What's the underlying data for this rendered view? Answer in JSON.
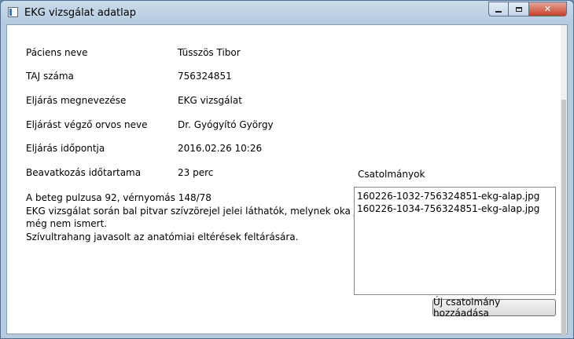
{
  "window": {
    "title": "EKG vizsgálat adatlap",
    "minimize": "minimize",
    "maximize": "maximize",
    "close_glyph": "✕"
  },
  "fields": [
    {
      "label": "Páciens neve",
      "value": "Tüsszös Tibor"
    },
    {
      "label": "TAJ száma",
      "value": "756324851"
    },
    {
      "label": "Eljárás megnevezése",
      "value": "EKG vizsgálat"
    },
    {
      "label": "Eljárást végző orvos neve",
      "value": "Dr. Gyógyító György"
    },
    {
      "label": "Eljárás időpontja",
      "value": "2016.02.26 10:26"
    },
    {
      "label": "Beavatkozás időtartama",
      "value": "23 perc"
    }
  ],
  "notes": [
    "A beteg pulzusa 92, vérnyomás 148/78",
    "EKG vizsgálat során bal pitvar szívzörejel jelei láthatók, melynek oka jelenleg",
    "még nem ismert.",
    "Szívultrahang javasolt az anatómiai eltérések feltárására."
  ],
  "attachments": {
    "title": "Csatolmányok",
    "items": [
      "160226-1032-756324851-ekg-alap.jpg",
      "160226-1034-756324851-ekg-alap.jpg"
    ],
    "add_button": "Új csatolmány hozzáadása"
  }
}
